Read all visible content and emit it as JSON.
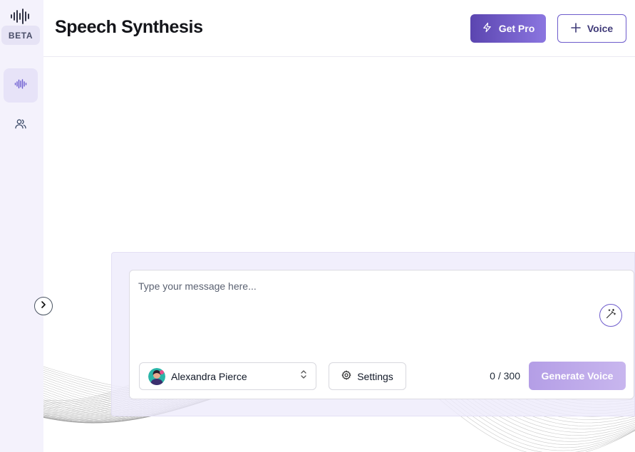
{
  "sidebar": {
    "logo_icon": "soundwave-logo-icon",
    "badge": "BETA",
    "nav": [
      {
        "icon": "waveform-icon",
        "active": true
      },
      {
        "icon": "users-icon",
        "active": false
      }
    ],
    "toggle_icon": "chevron-right-icon"
  },
  "header": {
    "title": "Speech Synthesis",
    "pro_button": {
      "label": "Get Pro",
      "icon": "lightning-icon"
    },
    "voice_button": {
      "label": "Voice",
      "icon": "plus-icon"
    }
  },
  "composer": {
    "placeholder": "Type your message here...",
    "value": "",
    "enhance_icon": "magic-wand-icon",
    "voice_select": {
      "selected": "Alexandra Pierce",
      "icon": "chevrons-up-down-icon"
    },
    "settings": {
      "label": "Settings",
      "icon": "gear-icon"
    },
    "char_count": "0 / 300",
    "generate_label": "Generate Voice"
  },
  "colors": {
    "accent": "#5b45b0",
    "accent_light": "#8b76e0",
    "sidebar_bg": "#f4f2fc",
    "panel_bg": "#edeafb",
    "generate_disabled": "#b49ee6"
  }
}
